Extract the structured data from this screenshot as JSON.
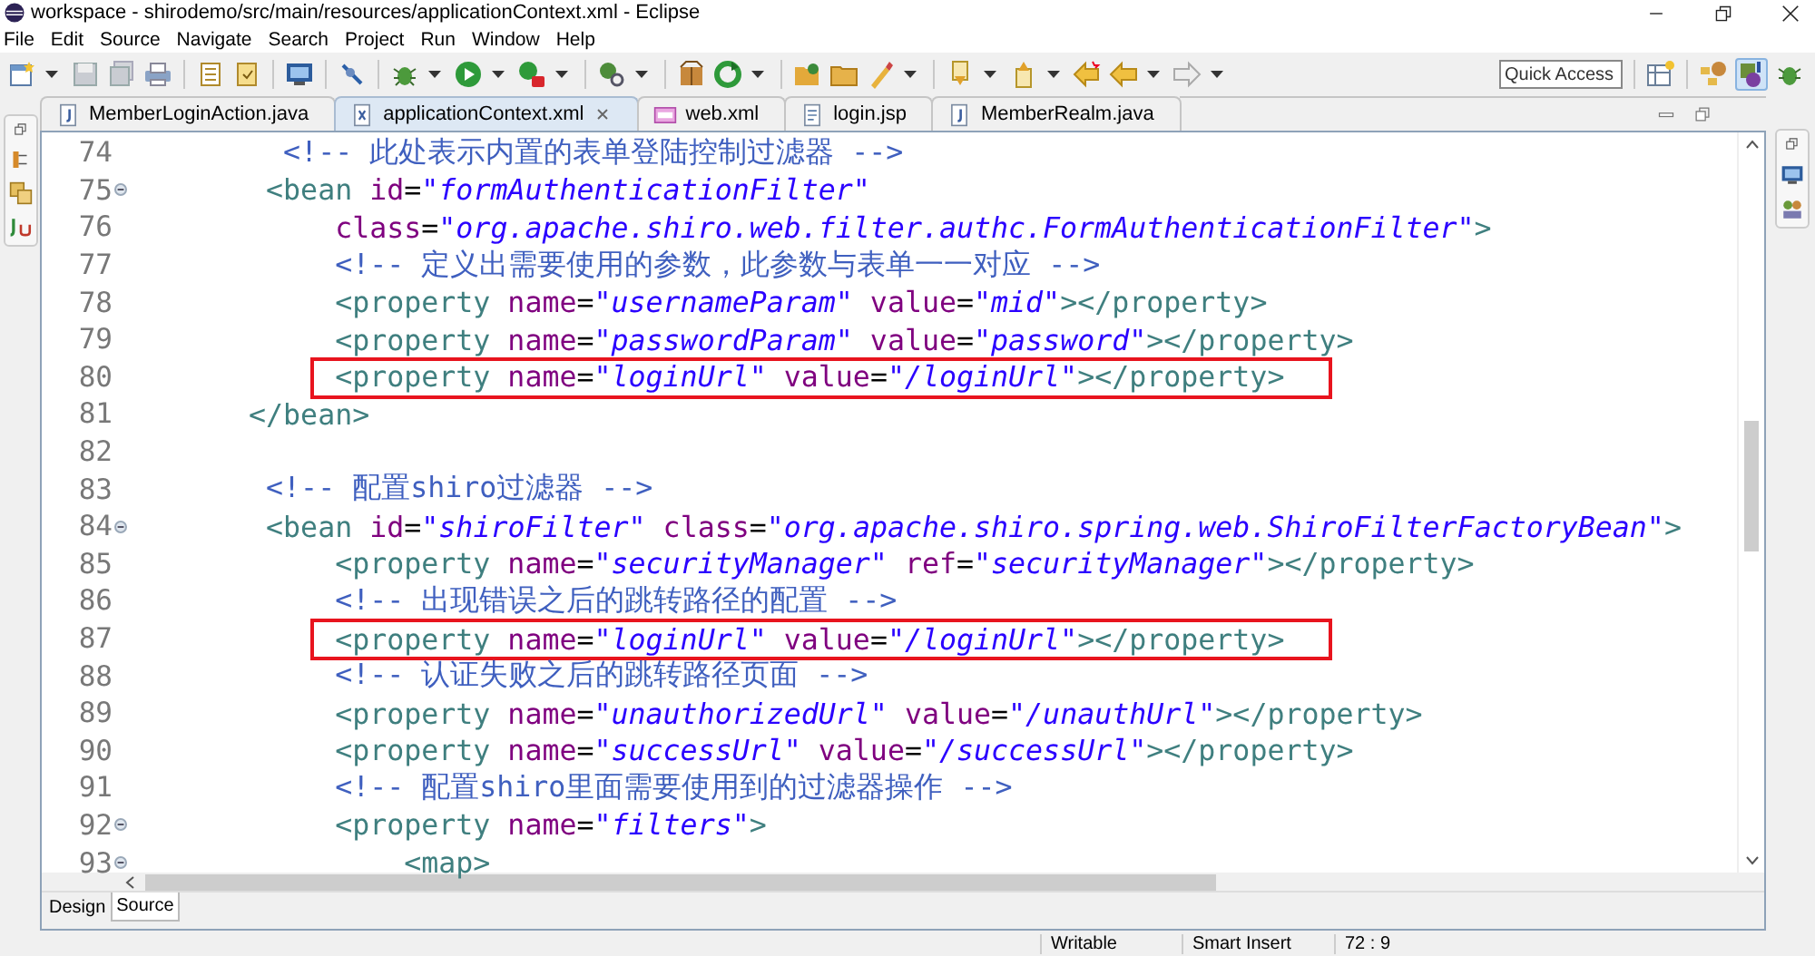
{
  "window": {
    "title": "workspace - shirodemo/src/main/resources/applicationContext.xml - Eclipse"
  },
  "menu": [
    "File",
    "Edit",
    "Source",
    "Navigate",
    "Search",
    "Project",
    "Run",
    "Window",
    "Help"
  ],
  "quick_access": {
    "placeholder": "Quick Access"
  },
  "tabs": [
    {
      "label": "MemberLoginAction.java",
      "kind": "java",
      "selected": false
    },
    {
      "label": "applicationContext.xml",
      "kind": "xml",
      "selected": true
    },
    {
      "label": "web.xml",
      "kind": "web",
      "selected": false
    },
    {
      "label": "login.jsp",
      "kind": "jsp",
      "selected": false
    },
    {
      "label": "MemberRealm.java",
      "kind": "java",
      "selected": false
    }
  ],
  "code_lines": [
    {
      "number": "74",
      "fold": false,
      "annotated": false,
      "tokens": [
        {
          "kind": "comment",
          "text": "    <!-- 此处表示内置的表单登陆控制过滤器 -->"
        }
      ]
    },
    {
      "number": "75",
      "fold": true,
      "annotated": false,
      "tokens": [
        {
          "kind": "tag",
          "text": "   <bean"
        },
        {
          "kind": "attr",
          "text": " id"
        },
        {
          "kind": "plain",
          "text": "="
        },
        {
          "kind": "value",
          "text": "\"formAuthenticationFilter\""
        }
      ]
    },
    {
      "number": "76",
      "fold": false,
      "annotated": false,
      "tokens": [
        {
          "kind": "attr",
          "text": "       class"
        },
        {
          "kind": "plain",
          "text": "="
        },
        {
          "kind": "value",
          "text": "\"org.apache.shiro.web.filter.authc.FormAuthenticationFilter\""
        },
        {
          "kind": "tag",
          "text": ">"
        }
      ]
    },
    {
      "number": "77",
      "fold": false,
      "annotated": false,
      "tokens": [
        {
          "kind": "comment",
          "text": "       <!-- 定义出需要使用的参数，此参数与表单一一对应 -->"
        }
      ]
    },
    {
      "number": "78",
      "fold": false,
      "annotated": false,
      "tokens": [
        {
          "kind": "tag",
          "text": "       <property"
        },
        {
          "kind": "attr",
          "text": " name"
        },
        {
          "kind": "plain",
          "text": "="
        },
        {
          "kind": "value",
          "text": "\"usernameParam\""
        },
        {
          "kind": "attr",
          "text": " value"
        },
        {
          "kind": "plain",
          "text": "="
        },
        {
          "kind": "value",
          "text": "\"mid\""
        },
        {
          "kind": "tag",
          "text": "></property>"
        }
      ]
    },
    {
      "number": "79",
      "fold": false,
      "annotated": false,
      "tokens": [
        {
          "kind": "tag",
          "text": "       <property"
        },
        {
          "kind": "attr",
          "text": " name"
        },
        {
          "kind": "plain",
          "text": "="
        },
        {
          "kind": "value",
          "text": "\"passwordParam\""
        },
        {
          "kind": "attr",
          "text": " value"
        },
        {
          "kind": "plain",
          "text": "="
        },
        {
          "kind": "value",
          "text": "\"password\""
        },
        {
          "kind": "tag",
          "text": "></property>"
        }
      ]
    },
    {
      "number": "80",
      "fold": false,
      "annotated": true,
      "tokens": [
        {
          "kind": "tag",
          "text": "       <property"
        },
        {
          "kind": "attr",
          "text": " name"
        },
        {
          "kind": "plain",
          "text": "="
        },
        {
          "kind": "value",
          "text": "\"loginUrl\""
        },
        {
          "kind": "attr",
          "text": " value"
        },
        {
          "kind": "plain",
          "text": "="
        },
        {
          "kind": "value",
          "text": "\"/loginUrl\""
        },
        {
          "kind": "tag",
          "text": "></property>"
        }
      ]
    },
    {
      "number": "81",
      "fold": false,
      "annotated": false,
      "tokens": [
        {
          "kind": "tag",
          "text": "  </bean>"
        }
      ]
    },
    {
      "number": "82",
      "fold": false,
      "annotated": false
    },
    {
      "number": "83",
      "fold": false,
      "annotated": false,
      "tokens": [
        {
          "kind": "comment",
          "text": "   <!-- 配置shiro过滤器 -->"
        }
      ]
    },
    {
      "number": "84",
      "fold": true,
      "annotated": false,
      "tokens": [
        {
          "kind": "tag",
          "text": "   <bean"
        },
        {
          "kind": "attr",
          "text": " id"
        },
        {
          "kind": "plain",
          "text": "="
        },
        {
          "kind": "value",
          "text": "\"shiroFilter\""
        },
        {
          "kind": "attr",
          "text": " class"
        },
        {
          "kind": "plain",
          "text": "="
        },
        {
          "kind": "value",
          "text": "\"org.apache.shiro.spring.web.ShiroFilterFactoryBean\""
        },
        {
          "kind": "tag",
          "text": ">"
        }
      ]
    },
    {
      "number": "85",
      "fold": false,
      "annotated": false,
      "tokens": [
        {
          "kind": "tag",
          "text": "       <property"
        },
        {
          "kind": "attr",
          "text": " name"
        },
        {
          "kind": "plain",
          "text": "="
        },
        {
          "kind": "value",
          "text": "\"securityManager\""
        },
        {
          "kind": "attr",
          "text": " ref"
        },
        {
          "kind": "plain",
          "text": "="
        },
        {
          "kind": "value",
          "text": "\"securityManager\""
        },
        {
          "kind": "tag",
          "text": "></property>"
        }
      ]
    },
    {
      "number": "86",
      "fold": false,
      "annotated": false,
      "tokens": [
        {
          "kind": "comment",
          "text": "       <!-- 出现错误之后的跳转路径的配置 -->"
        }
      ]
    },
    {
      "number": "87",
      "fold": false,
      "annotated": true,
      "tokens": [
        {
          "kind": "tag",
          "text": "       <property"
        },
        {
          "kind": "attr",
          "text": " name"
        },
        {
          "kind": "plain",
          "text": "="
        },
        {
          "kind": "value",
          "text": "\"loginUrl\""
        },
        {
          "kind": "attr",
          "text": " value"
        },
        {
          "kind": "plain",
          "text": "="
        },
        {
          "kind": "value",
          "text": "\"/loginUrl\""
        },
        {
          "kind": "tag",
          "text": "></property>"
        }
      ]
    },
    {
      "number": "88",
      "fold": false,
      "annotated": false,
      "tokens": [
        {
          "kind": "comment",
          "text": "       <!-- 认证失败之后的跳转路径页面 -->"
        }
      ]
    },
    {
      "number": "89",
      "fold": false,
      "annotated": false,
      "tokens": [
        {
          "kind": "tag",
          "text": "       <property"
        },
        {
          "kind": "attr",
          "text": " name"
        },
        {
          "kind": "plain",
          "text": "="
        },
        {
          "kind": "value",
          "text": "\"unauthorizedUrl\""
        },
        {
          "kind": "attr",
          "text": " value"
        },
        {
          "kind": "plain",
          "text": "="
        },
        {
          "kind": "value",
          "text": "\"/unauthUrl\""
        },
        {
          "kind": "tag",
          "text": "></property>"
        }
      ]
    },
    {
      "number": "90",
      "fold": false,
      "annotated": false,
      "tokens": [
        {
          "kind": "tag",
          "text": "       <property"
        },
        {
          "kind": "attr",
          "text": " name"
        },
        {
          "kind": "plain",
          "text": "="
        },
        {
          "kind": "value",
          "text": "\"successUrl\""
        },
        {
          "kind": "attr",
          "text": " value"
        },
        {
          "kind": "plain",
          "text": "="
        },
        {
          "kind": "value",
          "text": "\"/successUrl\""
        },
        {
          "kind": "tag",
          "text": "></property>"
        }
      ]
    },
    {
      "number": "91",
      "fold": false,
      "annotated": false,
      "tokens": [
        {
          "kind": "comment",
          "text": "       <!-- 配置shiro里面需要使用到的过滤器操作 -->"
        }
      ]
    },
    {
      "number": "92",
      "fold": true,
      "annotated": false,
      "tokens": [
        {
          "kind": "tag",
          "text": "       <property"
        },
        {
          "kind": "attr",
          "text": " name"
        },
        {
          "kind": "plain",
          "text": "="
        },
        {
          "kind": "value",
          "text": "\"filters\""
        },
        {
          "kind": "tag",
          "text": ">"
        }
      ]
    },
    {
      "number": "93",
      "fold": true,
      "annotated": false,
      "tokens": [
        {
          "kind": "tag",
          "text": "           <map>"
        }
      ]
    }
  ],
  "editor_tabs": [
    {
      "label": "Design",
      "selected": false
    },
    {
      "label": "Source",
      "selected": true
    }
  ],
  "status_bar": [
    "Writable",
    "Smart Insert",
    "72 : 9"
  ]
}
